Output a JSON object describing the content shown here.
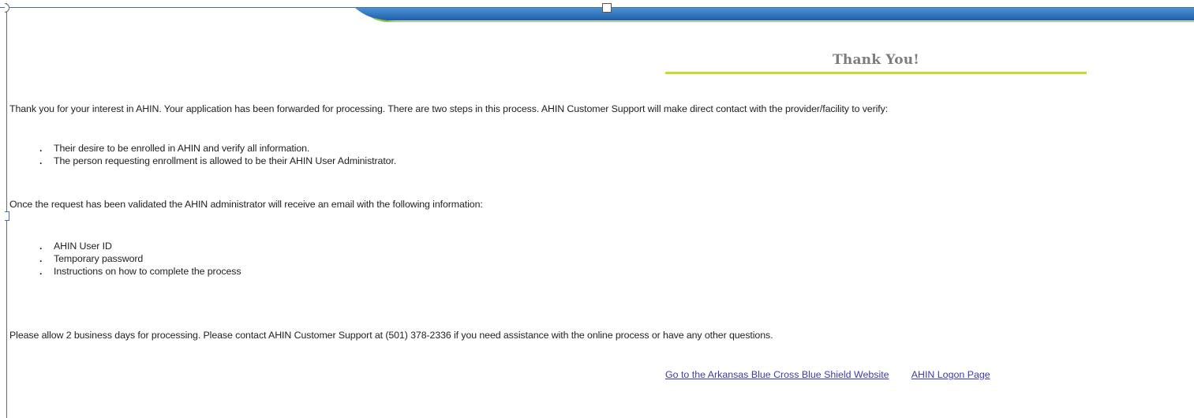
{
  "header": {
    "title": "Thank You!",
    "accent_color": "#c6dd2a",
    "banner_colors": [
      "#1f5fa8",
      "#4a8fd3",
      "#8fc63f"
    ]
  },
  "intro": "Thank you for your interest in AHIN. Your application has been forwarded for processing. There are two steps in this process. AHIN Customer Support will make direct contact with the provider/facility to verify:",
  "verify_items": [
    "Their desire to be enrolled in AHIN and verify all information.",
    "The person requesting enrollment is allowed to be their AHIN User Administrator."
  ],
  "validated_text": "Once the request has been validated the AHIN administrator will receive an email with the following information:",
  "email_items": [
    "AHIN User ID",
    "Temporary password",
    "Instructions on how to complete the process"
  ],
  "processing_text": "Please allow 2 business days for processing. Please contact AHIN Customer Support at (501) 378-2336 if you need assistance with the online process or have any other questions.",
  "links": {
    "bcbs": "Go to the Arkansas Blue Cross Blue Shield Website",
    "logon": "AHIN Logon Page"
  }
}
